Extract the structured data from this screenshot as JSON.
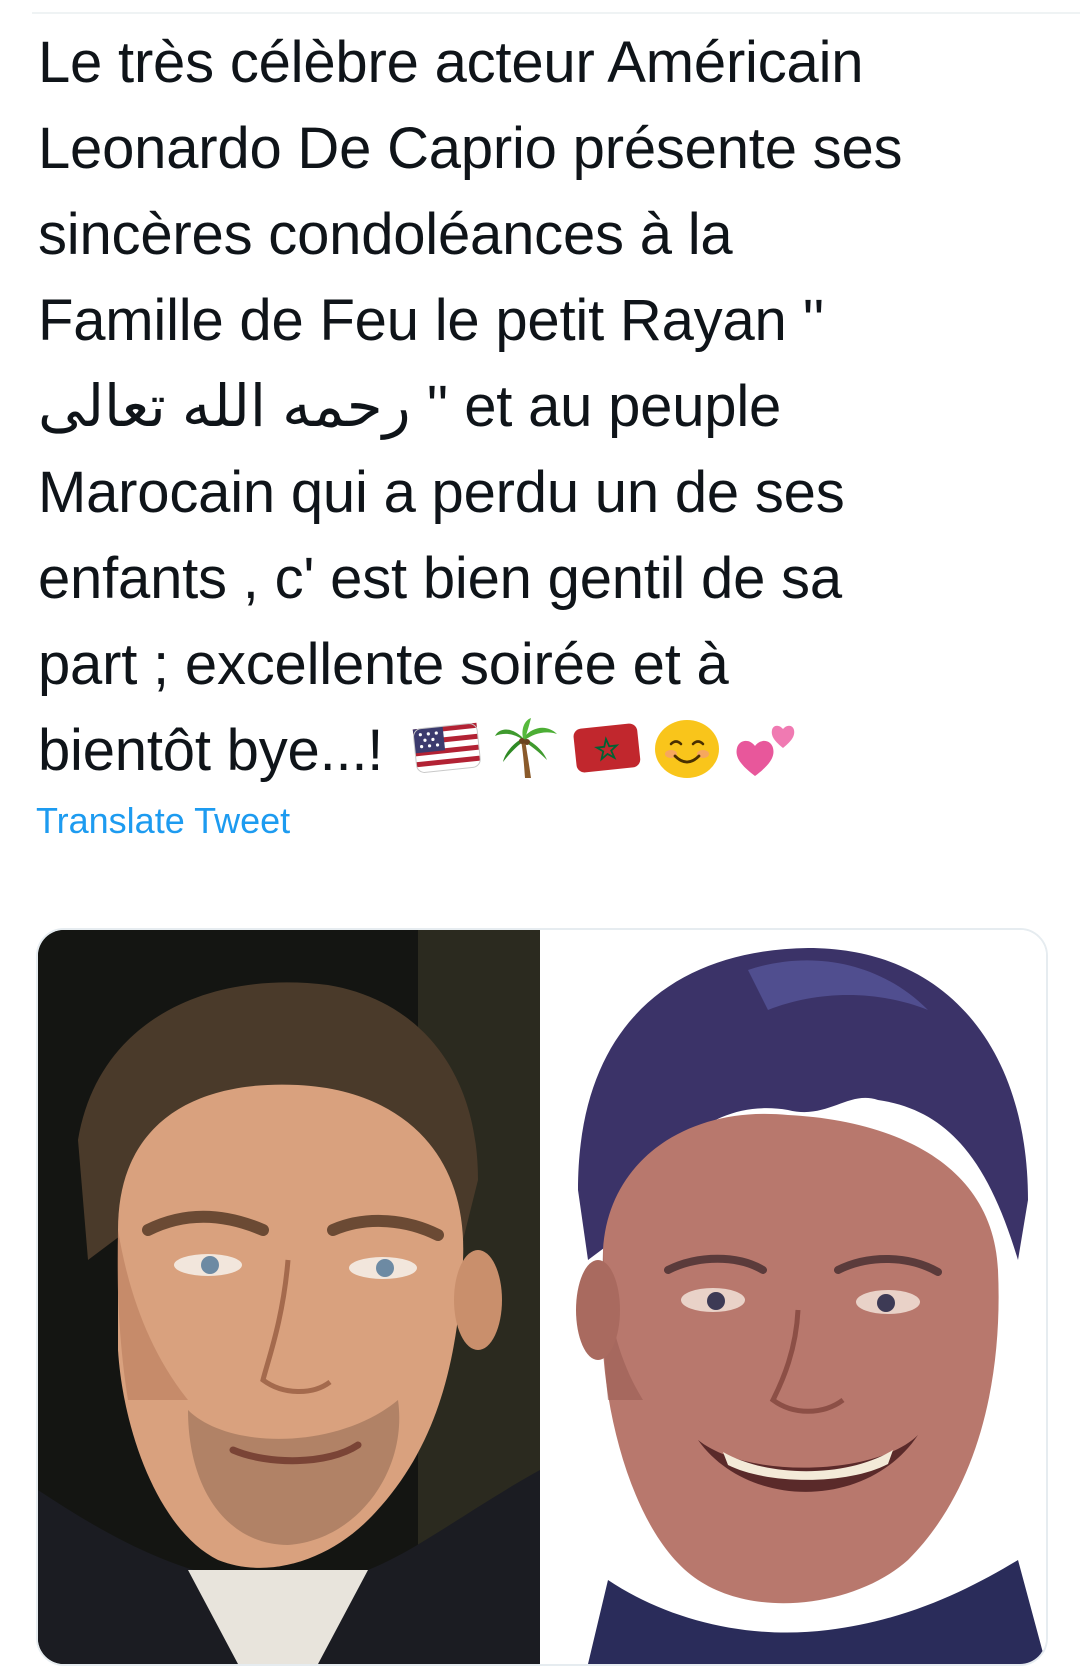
{
  "tweet": {
    "text_lines": [
      "Le très célèbre acteur Américain",
      "Leonardo De Caprio présente ses",
      "sincères condoléances à la",
      "Famille de Feu le petit Rayan ''"
    ],
    "line5_arabic": "رحمه الله تعالى",
    "line5_rest": "'' et au peuple",
    "text_lines_2": [
      "Marocain qui a perdu un de ses",
      "enfants , c' est bien gentil de sa",
      "part ; excellente soirée et à"
    ],
    "last_line_text": "bientôt bye...!",
    "emojis": [
      "us-flag-emoji",
      "palm-tree-emoji",
      "morocco-flag-emoji",
      "smiling-face-emoji",
      "two-hearts-emoji"
    ],
    "translate_label": "Translate Tweet"
  },
  "media": {
    "photos": [
      "man-portrait-photo",
      "boy-portrait-photo"
    ]
  },
  "colors": {
    "text": "#0f1419",
    "link": "#1d9bf0",
    "divider": "#eff3f4"
  }
}
